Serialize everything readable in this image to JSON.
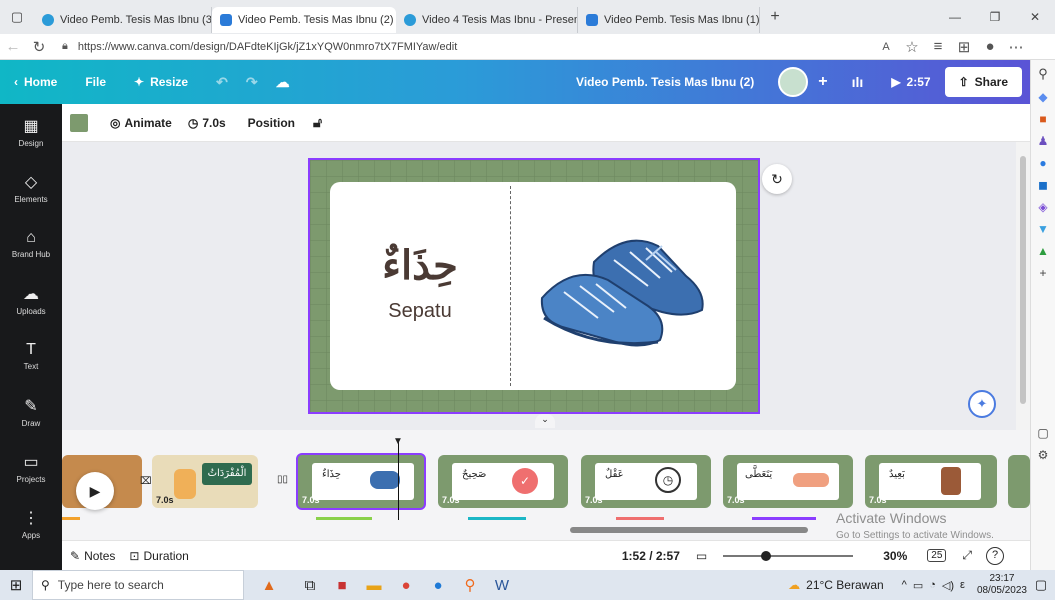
{
  "browser": {
    "tabs": [
      {
        "label": "Video Pemb. Tesis Mas Ibnu (3) - ",
        "color": "#2b9bd8"
      },
      {
        "label": "Video Pemb. Tesis Mas Ibnu (2) - ",
        "color": "#2b9bd8"
      },
      {
        "label": "Video 4 Tesis Mas Ibnu - Present",
        "color": "#2b9bd8"
      },
      {
        "label": "Video Pemb. Tesis Mas Ibnu (1) - ",
        "color": "#2b9bd8"
      }
    ],
    "close_glyph": "×",
    "new_tab_glyph": "+",
    "window_controls": [
      "—",
      "❐",
      "✕"
    ],
    "url": "https://www.canva.com/design/DAFdteKIjGk/jZ1xYQW0nmro7tX7FMIYaw/edit"
  },
  "canva_header": {
    "home": "Home",
    "file": "File",
    "resize": "Resize",
    "title": "Video Pemb. Tesis Mas Ibnu (2)",
    "play_time": "2:57",
    "share": "Share"
  },
  "rail": [
    {
      "label": "Design",
      "icon": "▦"
    },
    {
      "label": "Elements",
      "icon": "◇"
    },
    {
      "label": "Brand Hub",
      "icon": "⌂"
    },
    {
      "label": "Uploads",
      "icon": "☁"
    },
    {
      "label": "Text",
      "icon": "T"
    },
    {
      "label": "Draw",
      "icon": "✎"
    },
    {
      "label": "Projects",
      "icon": "▭"
    },
    {
      "label": "Apps",
      "icon": "⋮"
    }
  ],
  "toolbar": {
    "animate": "Animate",
    "duration": "7.0s",
    "position": "Position",
    "swatch_color": "#7d9a6e"
  },
  "slide": {
    "arabic_word": "حِذَاءٌ",
    "meaning": "Sepatu",
    "bg_color": "#7d9a6e"
  },
  "timeline": {
    "clips": [
      {
        "dur": "7.0s",
        "word": "الْمُفْرَدَاتُ"
      },
      {
        "dur": "7.0s",
        "word": "حِذَاءٌ"
      },
      {
        "dur": "7.0s",
        "word": "صَحِيحٌ"
      },
      {
        "dur": "7.0s",
        "word": "عَقْلٌ"
      },
      {
        "dur": "7.0s",
        "word": "يَتَعَطَّى"
      },
      {
        "dur": "7.0s",
        "word": "بَعِيدٌ"
      }
    ],
    "watermark_title": "Activate Windows",
    "watermark_sub": "Go to Settings to activate Windows."
  },
  "bottom": {
    "notes": "Notes",
    "duration": "Duration",
    "time": "1:52 / 2:57",
    "zoom": "30%",
    "page": "25"
  },
  "taskbar": {
    "search_placeholder": "Type here to search",
    "weather": "21°C Berawan",
    "time": "23:17",
    "date": "08/05/2023",
    "lang": "ε"
  }
}
